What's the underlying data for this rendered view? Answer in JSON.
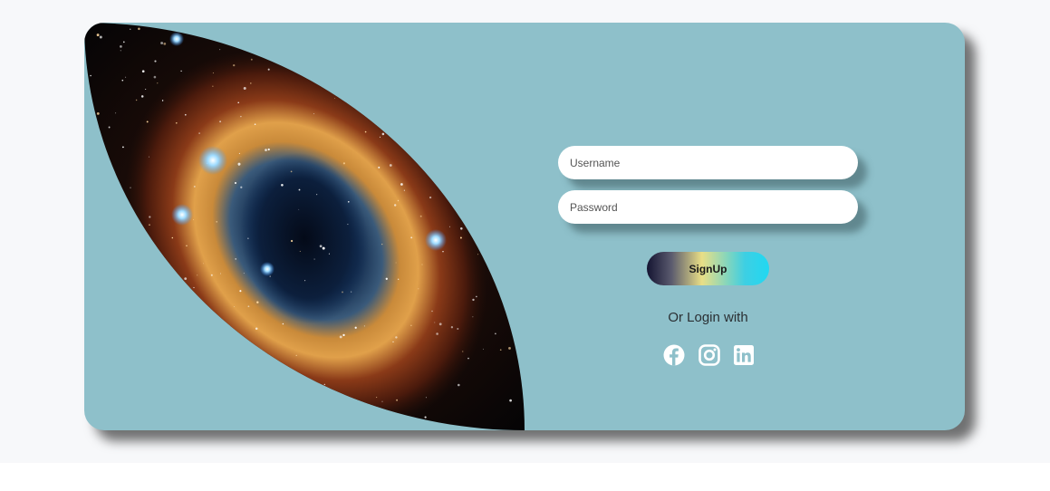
{
  "form": {
    "username_placeholder": "Username",
    "password_placeholder": "Password",
    "signup_label": "SignUp",
    "or_login_text": "Or Login with"
  },
  "social": [
    {
      "icon": "facebook-icon"
    },
    {
      "icon": "instagram-icon"
    },
    {
      "icon": "linkedin-icon"
    }
  ],
  "colors": {
    "card_background": "#8ec0ca",
    "page_background": "#f7f8fa",
    "signup_gradient": [
      "#141432",
      "#e9df86",
      "#20d8f2"
    ]
  }
}
